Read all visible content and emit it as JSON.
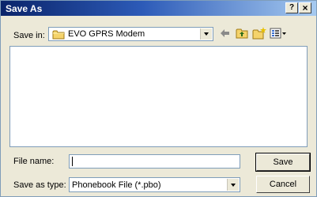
{
  "window": {
    "title": "Save As",
    "help_button": "?",
    "close_button": "×"
  },
  "save_in": {
    "label": "Save in:",
    "folder": "EVO GPRS Modem",
    "folder_icon": "folder-icon"
  },
  "toolbar": {
    "items": [
      {
        "name": "back-icon",
        "glyph": "←"
      },
      {
        "name": "up-folder-icon"
      },
      {
        "name": "new-folder-icon"
      },
      {
        "name": "view-menu-icon"
      }
    ]
  },
  "file_name": {
    "label": "File name:",
    "value": ""
  },
  "save_as_type": {
    "label": "Save as type:",
    "selected": "Phonebook File (*.pbo)"
  },
  "buttons": {
    "save": "Save",
    "cancel": "Cancel"
  },
  "colors": {
    "titlebar_start": "#0a246a",
    "titlebar_end": "#a6caf0",
    "dialog_bg": "#ece9d8",
    "folder_yellow": "#f5d36a"
  }
}
